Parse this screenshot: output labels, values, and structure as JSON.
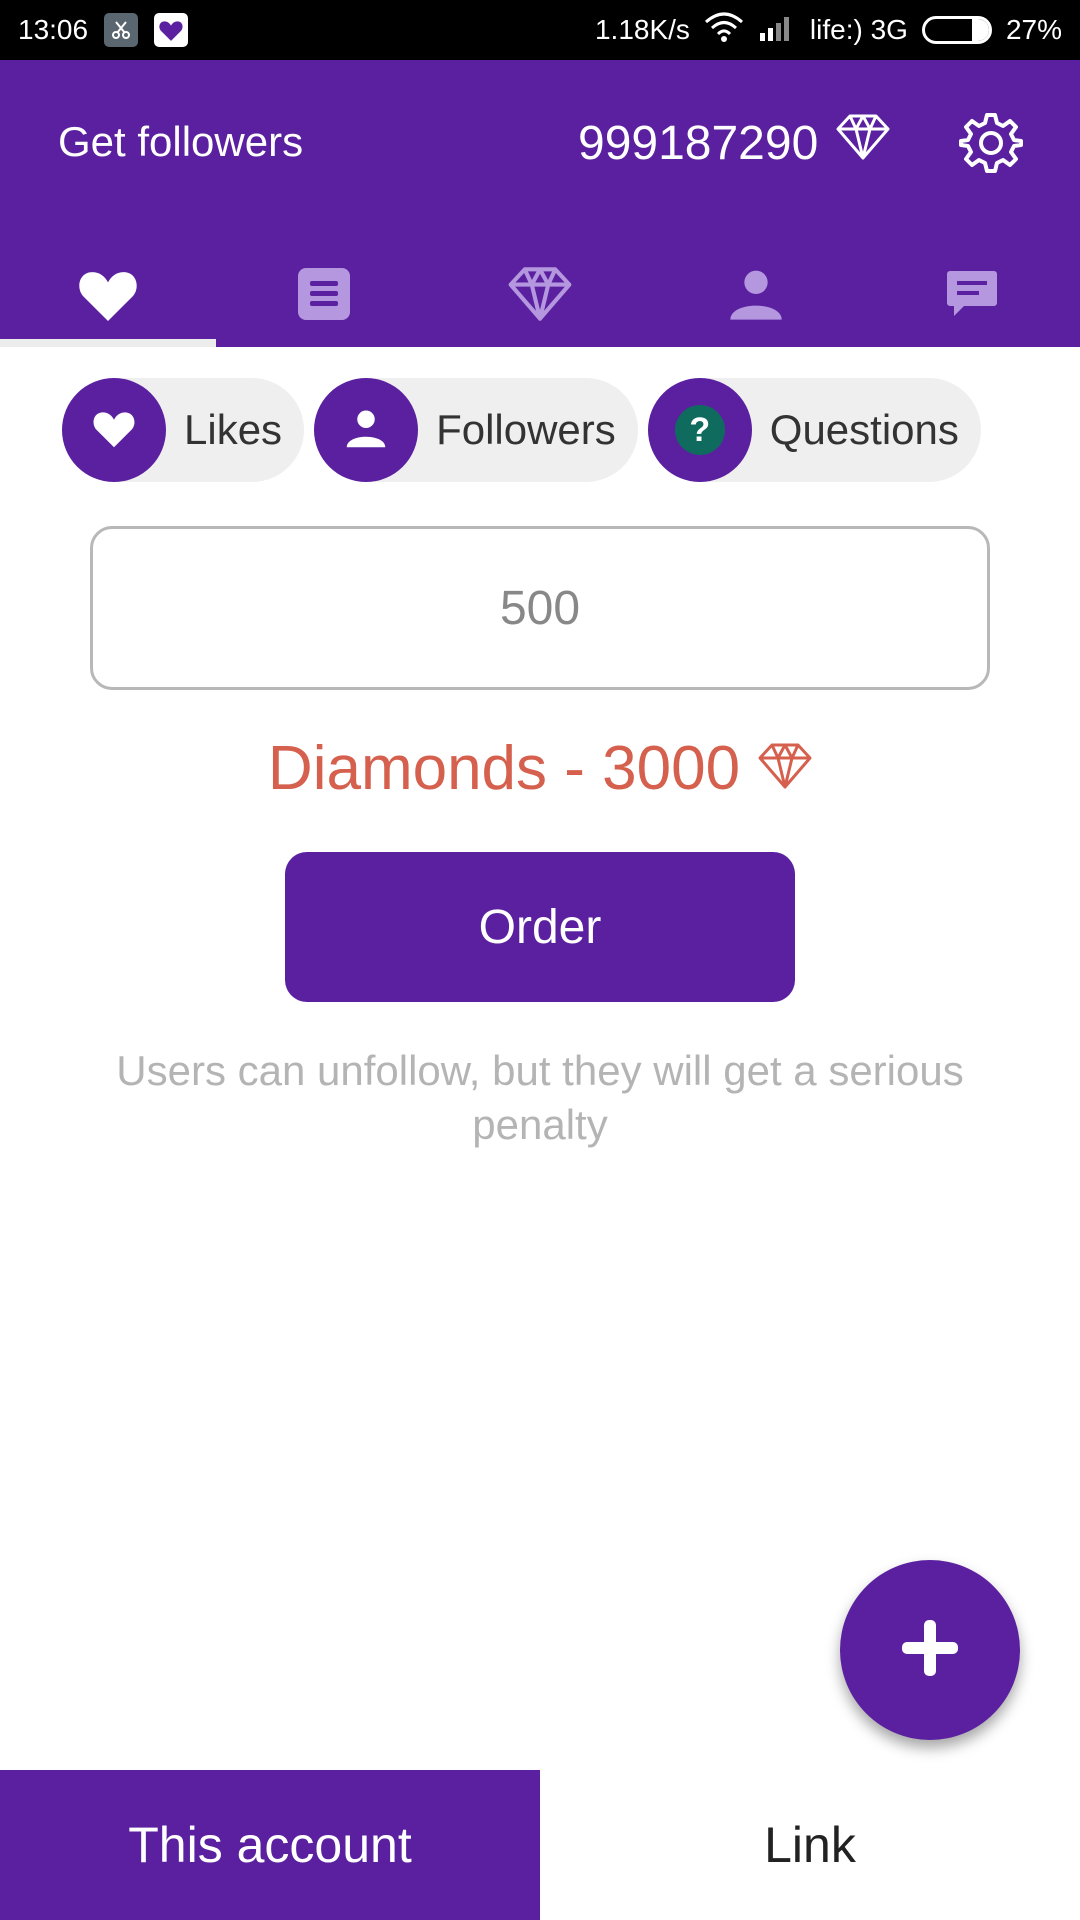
{
  "status_bar": {
    "time": "13:06",
    "net_speed": "1.18K/s",
    "carrier": "life:) 3G",
    "battery_pct": "27%",
    "battery_level": 0.27
  },
  "app_bar": {
    "title": "Get followers",
    "balance": "999187290",
    "balance_icon": "diamond-icon",
    "settings_icon": "gear-icon"
  },
  "tabs": [
    {
      "icon": "heart-icon",
      "active": true
    },
    {
      "icon": "list-icon",
      "active": false
    },
    {
      "icon": "diamond-icon",
      "active": false
    },
    {
      "icon": "person-icon",
      "active": false
    },
    {
      "icon": "chat-icon",
      "active": false
    }
  ],
  "chips": [
    {
      "label": "Likes",
      "icon": "heart-icon"
    },
    {
      "label": "Followers",
      "icon": "person-icon"
    },
    {
      "label": "Questions",
      "icon": "question-icon"
    }
  ],
  "quantity": {
    "placeholder": "500",
    "value": ""
  },
  "cost": {
    "text": "Diamonds - 3000",
    "icon": "diamond-icon"
  },
  "order_button": {
    "label": "Order"
  },
  "hint": "Users can unfollow, but they will get a serious penalty",
  "fab": {
    "icon": "plus-icon"
  },
  "bottom_toggle": {
    "options": [
      "This account",
      "Link"
    ],
    "selected": "This account"
  },
  "colors": {
    "primary": "#5a20a0",
    "cost_red": "#d5604e",
    "question_badge": "#0e6b5e",
    "hint_gray": "#b4b4b4"
  }
}
